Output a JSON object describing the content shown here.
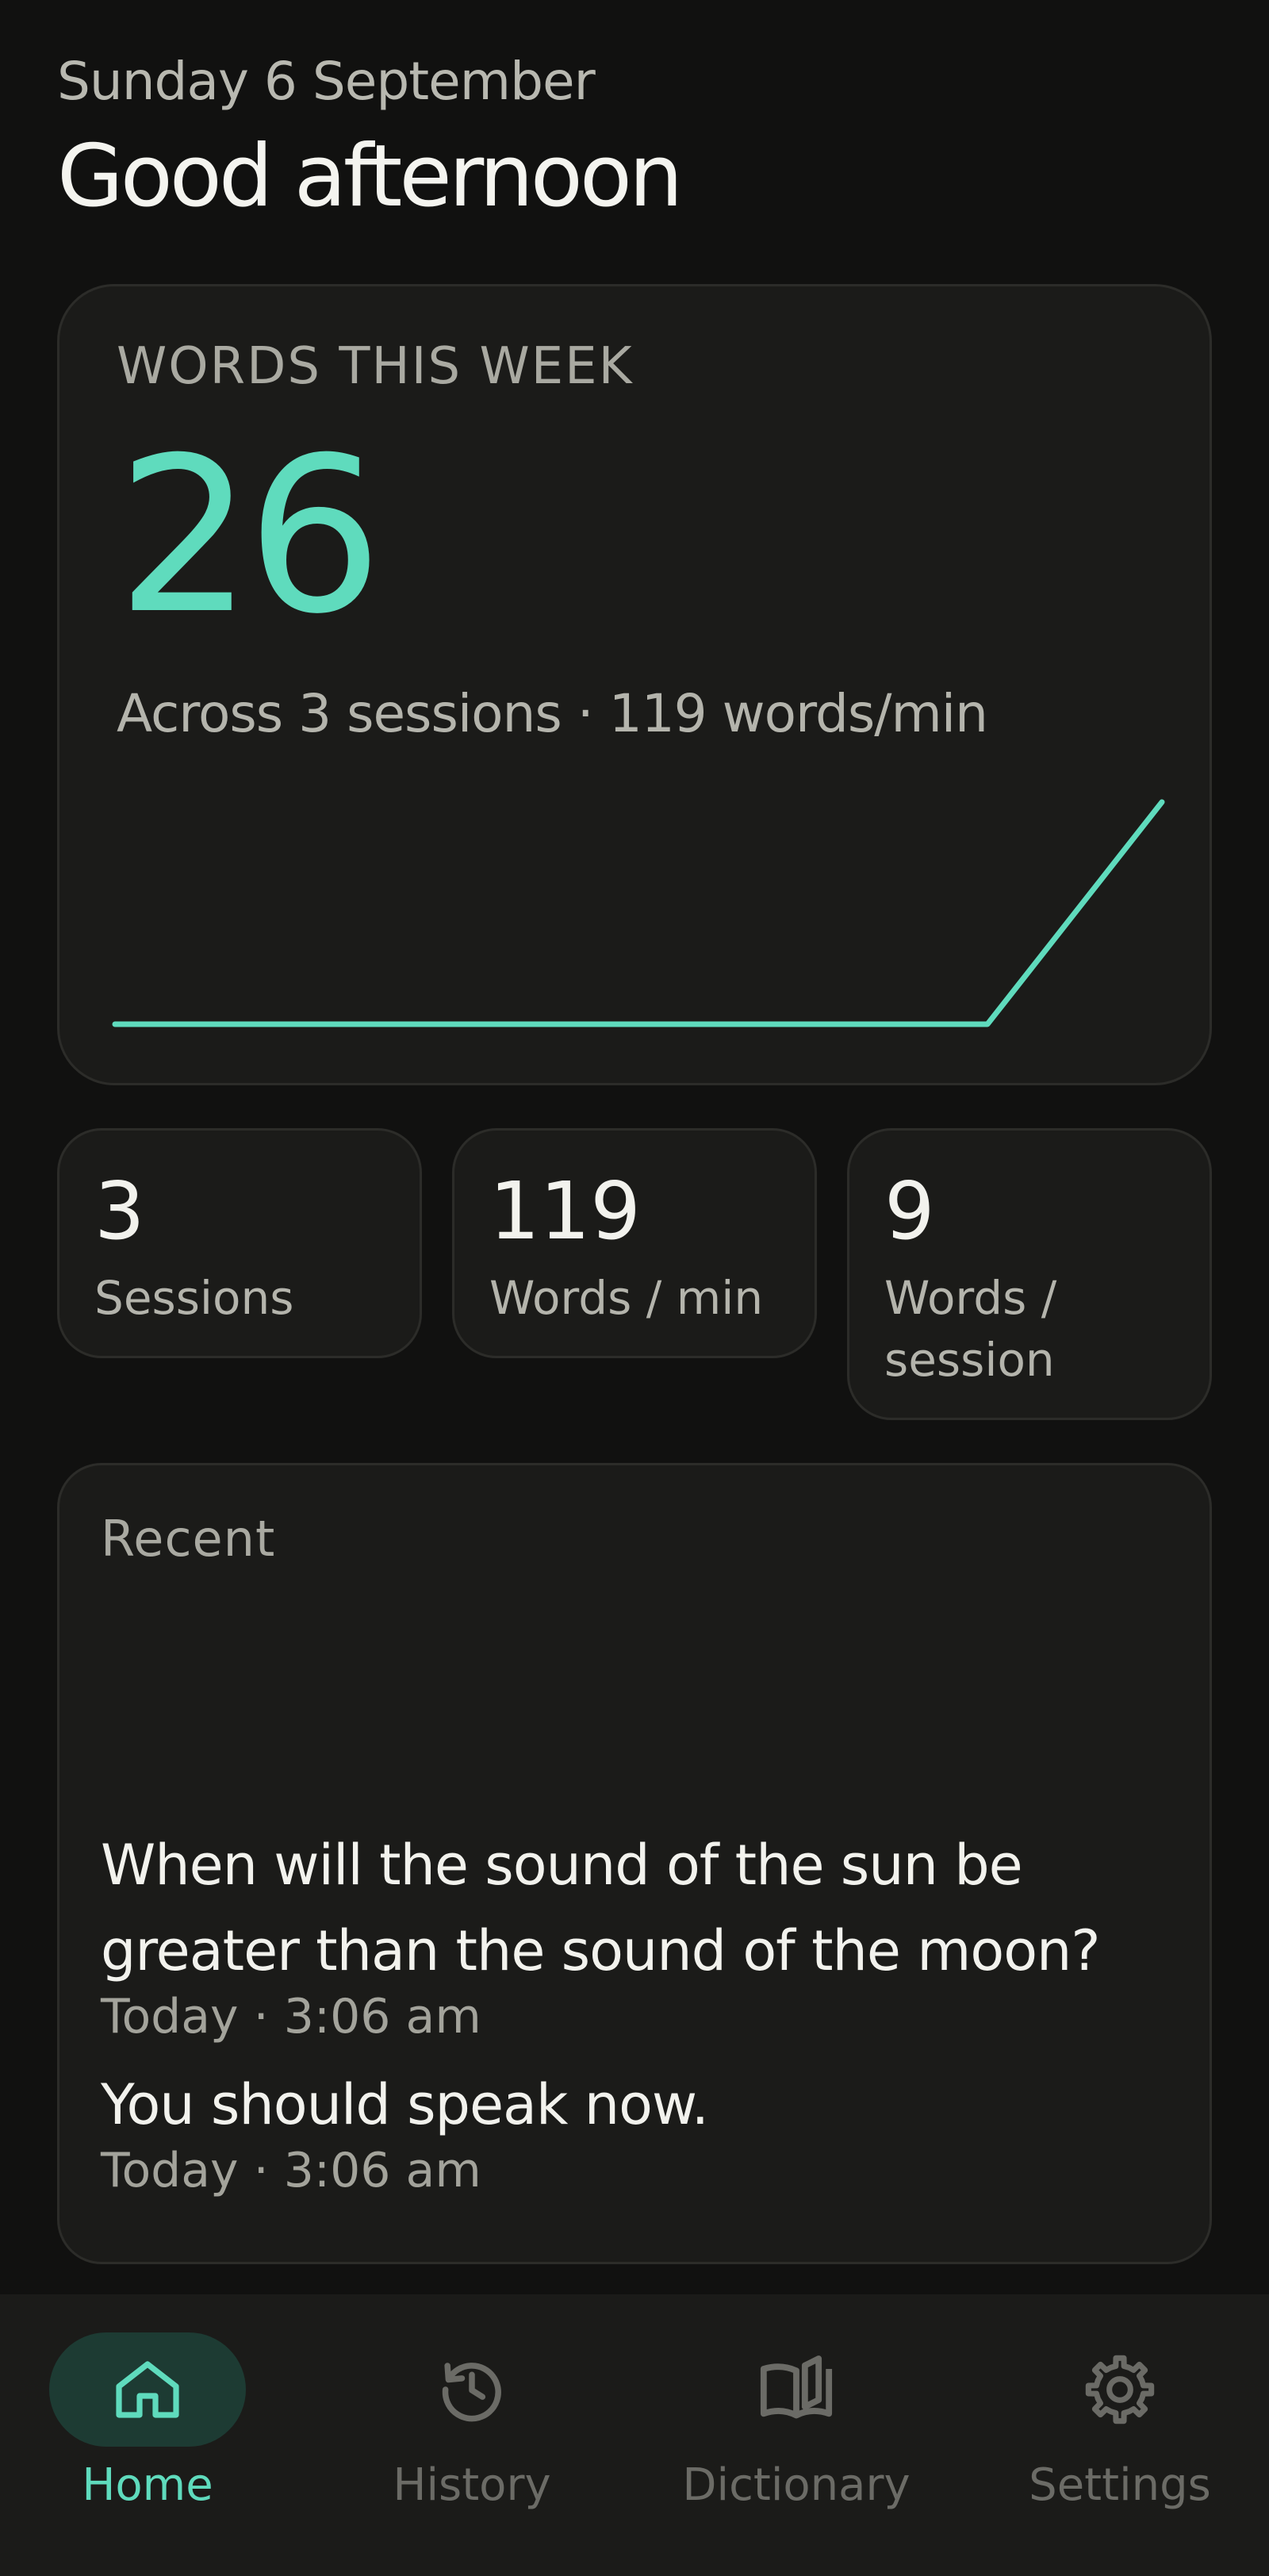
{
  "header": {
    "date": "Sunday 6 September",
    "greeting": "Good afternoon"
  },
  "summary": {
    "title": "WORDS THIS WEEK",
    "value": "26",
    "subtitle": "Across 3 sessions · 119 words/min",
    "sparkline_trend": [
      0,
      0,
      0,
      0,
      0,
      0,
      26
    ]
  },
  "stats": [
    {
      "value": "3",
      "label": "Sessions"
    },
    {
      "value": "119",
      "label": "Words / min"
    },
    {
      "value": "9",
      "label": "Words / session"
    }
  ],
  "recent": {
    "title": "Recent",
    "items": [
      {
        "text": "When will the sound of the sun be greater than the sound of the moon?",
        "meta": "Today · 3:06 am"
      },
      {
        "text": "You should speak now.",
        "meta": "Today · 3:06 am"
      }
    ]
  },
  "nav": {
    "items": [
      {
        "label": "Home",
        "icon": "home-icon",
        "active": true
      },
      {
        "label": "History",
        "icon": "history-icon",
        "active": false
      },
      {
        "label": "Dictionary",
        "icon": "book-icon",
        "active": false
      },
      {
        "label": "Settings",
        "icon": "gear-icon",
        "active": false
      }
    ]
  },
  "colors": {
    "background": "#111110",
    "card": "#1b1b19",
    "accent": "#5fdbbd",
    "active_pill": "#1d3b33"
  }
}
